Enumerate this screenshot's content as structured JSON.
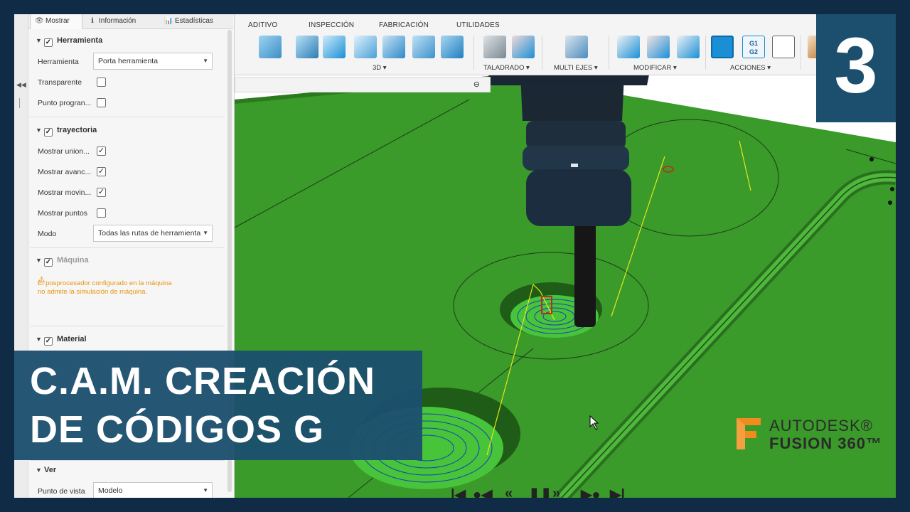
{
  "ribbon": {
    "tabs": [
      "ADITIVO",
      "INSPECCIÓN",
      "FABRICACIÓN",
      "UTILIDADES"
    ],
    "groups": [
      "3D ▾",
      "TALADRADO ▾",
      "MULTI EJES ▾",
      "MODIFICAR ▾",
      "ACCIONES ▾"
    ],
    "g1g2_label": "G1\nG2"
  },
  "panel": {
    "tabs": {
      "show": "Mostrar",
      "info": "Información",
      "stats": "Estadísticas",
      "show_icon": "👁",
      "info_icon": "ℹ",
      "stats_icon": "📊"
    },
    "herramienta_section": {
      "title": "Herramienta",
      "tool_label": "Herramienta",
      "tool_value": "Porta herramienta",
      "transparent_label": "Transparente",
      "punto_label": "Punto progran..."
    },
    "trayectoria_section": {
      "title": "trayectoria",
      "mostrar_union": "Mostrar union...",
      "mostrar_avance": "Mostrar avanc...",
      "mostrar_movin": "Mostrar movin...",
      "mostrar_puntos": "Mostrar puntos",
      "modo_label": "Modo",
      "modo_value": "Todas las rutas de herramienta"
    },
    "maquina_section": {
      "title": "Máquina",
      "warning_line1": "El posprocesador configurado en la máquina",
      "warning_line2": "no admite la simulación de máquina."
    },
    "material_section": {
      "title": "Material"
    },
    "ver_section": {
      "title": "Ver",
      "punto_vista_label": "Punto de vista",
      "punto_vista_value": "Modelo"
    }
  },
  "overlay": {
    "title_line1": "C.A.M. CREACIÓN",
    "title_line2": "DE CÓDIGOS G",
    "episode": "3",
    "logo_line1": "AUTODESK®",
    "logo_line2": "FUSION 360™"
  },
  "playback": {
    "first": "|◀",
    "prev_point": "●◀",
    "rewind": "«",
    "pause": "❚❚",
    "forward": "»",
    "next_point": "▶●",
    "last": "▶|"
  },
  "colors": {
    "title_bg": "#1c4f6e",
    "page_border": "#0f2b45",
    "plate_green": "#3a9a2a",
    "accent_blue": "#1a8fd6",
    "warning": "#e8950f",
    "logo_orange": "#f28b1e"
  }
}
